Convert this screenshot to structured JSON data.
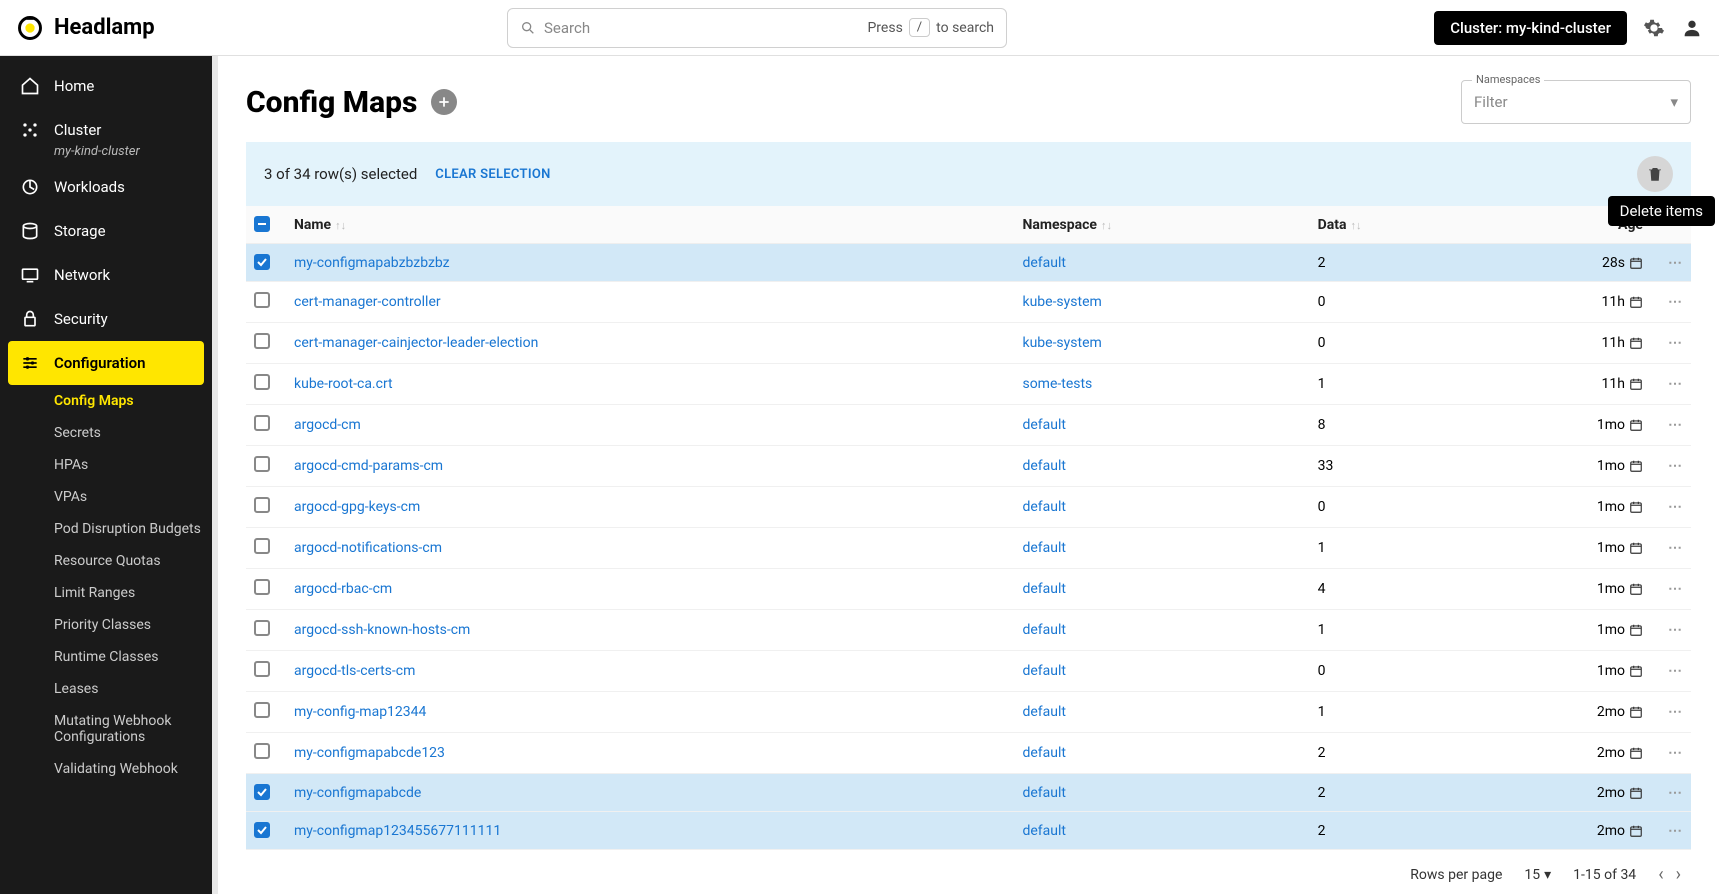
{
  "app_name": "Headlamp",
  "search": {
    "placeholder": "Search",
    "hint_press": "Press",
    "hint_key": "/",
    "hint_to": "to search"
  },
  "cluster_chip": "Cluster: my-kind-cluster",
  "sidebar": {
    "items": [
      {
        "label": "Home",
        "icon": "home"
      },
      {
        "label": "Cluster",
        "icon": "cluster",
        "sub": "my-kind-cluster"
      },
      {
        "label": "Workloads",
        "icon": "workloads"
      },
      {
        "label": "Storage",
        "icon": "storage"
      },
      {
        "label": "Network",
        "icon": "network"
      },
      {
        "label": "Security",
        "icon": "security"
      },
      {
        "label": "Configuration",
        "icon": "config",
        "active": true
      }
    ],
    "subnav": [
      {
        "label": "Config Maps",
        "active": true
      },
      {
        "label": "Secrets"
      },
      {
        "label": "HPAs"
      },
      {
        "label": "VPAs"
      },
      {
        "label": "Pod Disruption Budgets"
      },
      {
        "label": "Resource Quotas"
      },
      {
        "label": "Limit Ranges"
      },
      {
        "label": "Priority Classes"
      },
      {
        "label": "Runtime Classes"
      },
      {
        "label": "Leases"
      },
      {
        "label": "Mutating Webhook Configurations"
      },
      {
        "label": "Validating Webhook"
      }
    ]
  },
  "page": {
    "title": "Config Maps"
  },
  "ns_filter": {
    "label": "Namespaces",
    "placeholder": "Filter"
  },
  "selection": {
    "text": "3 of 34 row(s) selected",
    "clear": "CLEAR SELECTION",
    "tooltip": "Delete items"
  },
  "columns": {
    "name": "Name",
    "namespace": "Namespace",
    "data": "Data",
    "age": "Age"
  },
  "rows": [
    {
      "name": "my-configmapabzbzbzbz",
      "ns": "default",
      "data": "2",
      "age": "28s",
      "selected": true
    },
    {
      "name": "cert-manager-controller",
      "ns": "kube-system",
      "data": "0",
      "age": "11h"
    },
    {
      "name": "cert-manager-cainjector-leader-election",
      "ns": "kube-system",
      "data": "0",
      "age": "11h"
    },
    {
      "name": "kube-root-ca.crt",
      "ns": "some-tests",
      "data": "1",
      "age": "11h"
    },
    {
      "name": "argocd-cm",
      "ns": "default",
      "data": "8",
      "age": "1mo"
    },
    {
      "name": "argocd-cmd-params-cm",
      "ns": "default",
      "data": "33",
      "age": "1mo"
    },
    {
      "name": "argocd-gpg-keys-cm",
      "ns": "default",
      "data": "0",
      "age": "1mo"
    },
    {
      "name": "argocd-notifications-cm",
      "ns": "default",
      "data": "1",
      "age": "1mo"
    },
    {
      "name": "argocd-rbac-cm",
      "ns": "default",
      "data": "4",
      "age": "1mo"
    },
    {
      "name": "argocd-ssh-known-hosts-cm",
      "ns": "default",
      "data": "1",
      "age": "1mo"
    },
    {
      "name": "argocd-tls-certs-cm",
      "ns": "default",
      "data": "0",
      "age": "1mo"
    },
    {
      "name": "my-config-map12344",
      "ns": "default",
      "data": "1",
      "age": "2mo"
    },
    {
      "name": "my-configmapabcde123",
      "ns": "default",
      "data": "2",
      "age": "2mo"
    },
    {
      "name": "my-configmapabcde",
      "ns": "default",
      "data": "2",
      "age": "2mo",
      "selected": true
    },
    {
      "name": "my-configmap123455677111111",
      "ns": "default",
      "data": "2",
      "age": "2mo",
      "selected": true
    }
  ],
  "pagination": {
    "rpp_label": "Rows per page",
    "rpp_value": "15",
    "range": "1-15 of 34"
  }
}
